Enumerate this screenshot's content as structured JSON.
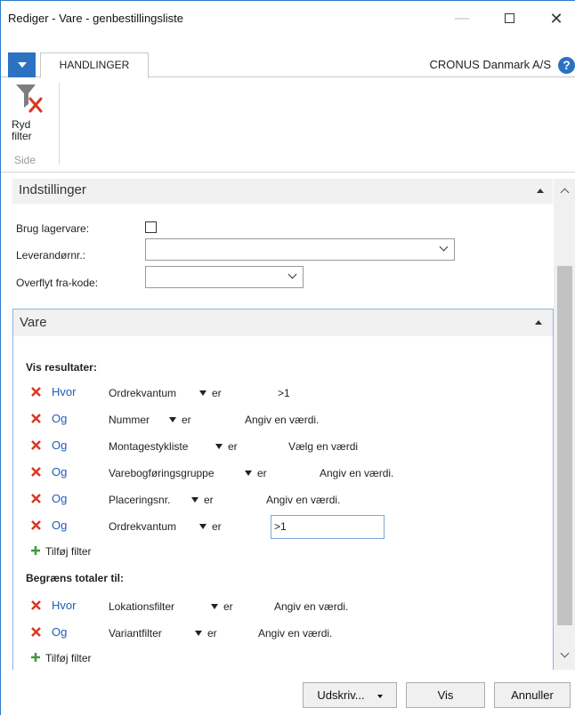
{
  "window": {
    "title": "Rediger - Vare - genbestillingsliste",
    "minimize": "—",
    "close": "✕"
  },
  "tabs": {
    "active_tab": "HANDLINGER",
    "company": "CRONUS Danmark A/S",
    "help": "?"
  },
  "ribbon": {
    "clear_filter_label_1": "Ryd",
    "clear_filter_label_2": "filter",
    "group_label": "Side"
  },
  "settings": {
    "title": "Indstillinger",
    "fields": [
      {
        "label": "Brug lagervare:",
        "type": "checkbox",
        "checked": false
      },
      {
        "label": "Leverandørnr.:",
        "type": "dropdown",
        "value": ""
      },
      {
        "label": "Overflyt fra-kode:",
        "type": "dropdown",
        "value": ""
      }
    ]
  },
  "item_section": {
    "title": "Vare",
    "show_results_title": "Vis resultater:",
    "filters": [
      {
        "conj": "Hvor",
        "field": "Ordrekvantum",
        "op": "er",
        "value": ">1"
      },
      {
        "conj": "Og",
        "field": "Nummer",
        "op": "er",
        "value": "Angiv en værdi."
      },
      {
        "conj": "Og",
        "field": "Montagestykliste",
        "op": "er",
        "value": "Vælg en værdi"
      },
      {
        "conj": "Og",
        "field": "Varebogføringsgruppe",
        "op": "er",
        "value": "Angiv en værdi."
      },
      {
        "conj": "Og",
        "field": "Placeringsnr.",
        "op": "er",
        "value": "Angiv en værdi."
      },
      {
        "conj": "Og",
        "field": "Ordrekvantum",
        "op": "er",
        "value": ">1"
      }
    ],
    "add_filter": "Tilføj filter",
    "limit_totals_title": "Begræns totaler til:",
    "totals_filters": [
      {
        "conj": "Hvor",
        "field": "Lokationsfilter",
        "op": "er",
        "value": "Angiv en værdi."
      },
      {
        "conj": "Og",
        "field": "Variantfilter",
        "op": "er",
        "value": "Angiv en værdi."
      }
    ],
    "add_filter_2": "Tilføj filter"
  },
  "footer": {
    "print": "Udskriv...",
    "show": "Vis",
    "cancel": "Annuller"
  },
  "colors": {
    "accent": "#2b72c2",
    "delete_red": "#d9381e",
    "add_green": "#3e9b3e",
    "link_blue": "#1f5cb4"
  }
}
